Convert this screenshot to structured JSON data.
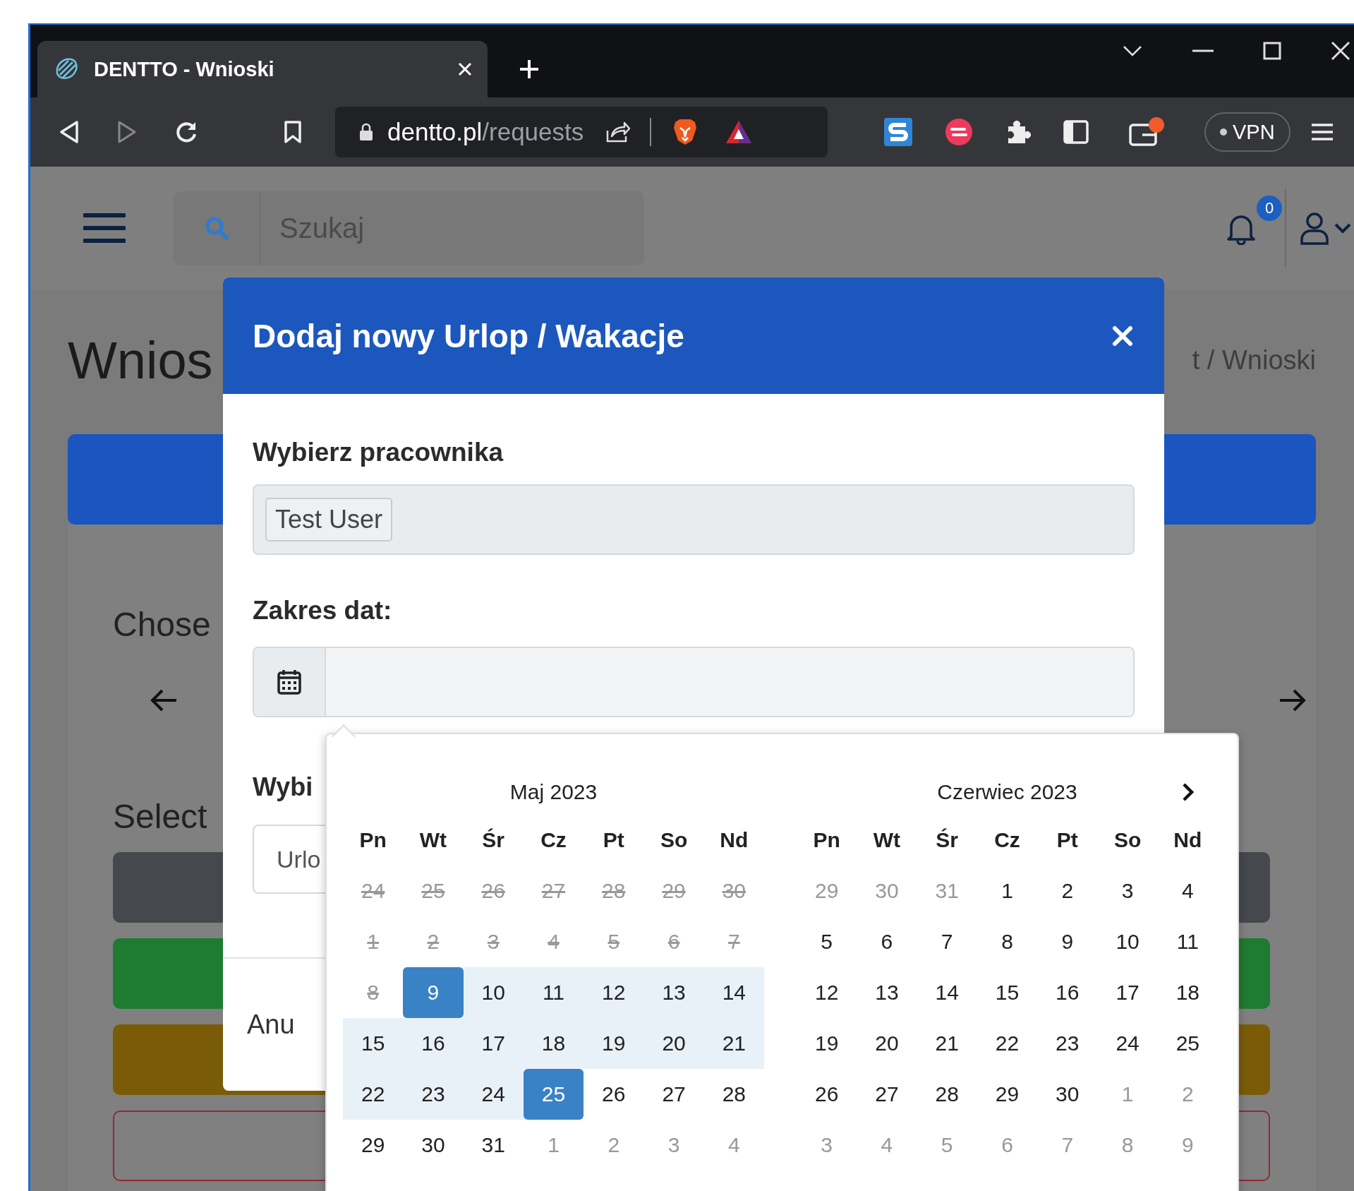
{
  "browser": {
    "tab": {
      "title": "DENTTO - Wnioski"
    },
    "address": {
      "host": "dentto.pl",
      "path": "/requests"
    },
    "vpn": "VPN"
  },
  "header": {
    "search": {
      "placeholder": "Szukaj"
    },
    "notifications": "0"
  },
  "page": {
    "heading": "Wnios",
    "breadcrumb": "t / Wnioski",
    "section_1": "Chose",
    "section_2": "Select",
    "bars": [
      {
        "kind": "filled",
        "color": "#45484d"
      },
      {
        "kind": "filled",
        "color": "#1f7a32"
      },
      {
        "kind": "filled",
        "color": "#7a5c08"
      },
      {
        "kind": "outline",
        "color": "#8c2b33"
      }
    ]
  },
  "modal": {
    "title": "Dodaj nowy Urlop / Wakacje",
    "employee_label": "Wybierz pracownika",
    "employee_tags": [
      "Test User"
    ],
    "date_label": "Zakres dat:",
    "type_label": "Wybi",
    "type_value": "Urlo",
    "cancel": "Anu"
  },
  "datepicker": {
    "calendars": [
      {
        "title": "Maj 2023",
        "weekdays": [
          "Pn",
          "Wt",
          "Śr",
          "Cz",
          "Pt",
          "So",
          "Nd"
        ],
        "weeks": [
          [
            {
              "day": "24",
              "kind": "disabled",
              "selected": false
            },
            {
              "day": "25",
              "kind": "disabled",
              "selected": false
            },
            {
              "day": "26",
              "kind": "disabled",
              "selected": false
            },
            {
              "day": "27",
              "kind": "disabled",
              "selected": false
            },
            {
              "day": "28",
              "kind": "disabled",
              "selected": false
            },
            {
              "day": "29",
              "kind": "disabled",
              "selected": false
            },
            {
              "day": "30",
              "kind": "disabled",
              "selected": false
            }
          ],
          [
            {
              "day": "1",
              "kind": "disabled",
              "selected": false
            },
            {
              "day": "2",
              "kind": "disabled",
              "selected": false
            },
            {
              "day": "3",
              "kind": "disabled",
              "selected": false
            },
            {
              "day": "4",
              "kind": "disabled",
              "selected": false
            },
            {
              "day": "5",
              "kind": "disabled",
              "selected": false
            },
            {
              "day": "6",
              "kind": "disabled",
              "selected": false
            },
            {
              "day": "7",
              "kind": "disabled",
              "selected": false
            }
          ],
          [
            {
              "day": "8",
              "kind": "disabled",
              "selected": false
            },
            {
              "day": "9",
              "kind": "range",
              "selected": true
            },
            {
              "day": "10",
              "kind": "range",
              "selected": false
            },
            {
              "day": "11",
              "kind": "range",
              "selected": false
            },
            {
              "day": "12",
              "kind": "range",
              "selected": false
            },
            {
              "day": "13",
              "kind": "range",
              "selected": false
            },
            {
              "day": "14",
              "kind": "range",
              "selected": false
            }
          ],
          [
            {
              "day": "15",
              "kind": "range",
              "selected": false
            },
            {
              "day": "16",
              "kind": "range",
              "selected": false
            },
            {
              "day": "17",
              "kind": "range",
              "selected": false
            },
            {
              "day": "18",
              "kind": "range",
              "selected": false
            },
            {
              "day": "19",
              "kind": "range",
              "selected": false
            },
            {
              "day": "20",
              "kind": "range",
              "selected": false
            },
            {
              "day": "21",
              "kind": "range",
              "selected": false
            }
          ],
          [
            {
              "day": "22",
              "kind": "range",
              "selected": false
            },
            {
              "day": "23",
              "kind": "range",
              "selected": false
            },
            {
              "day": "24",
              "kind": "range",
              "selected": false
            },
            {
              "day": "25",
              "kind": "range",
              "selected": true
            },
            {
              "day": "26",
              "kind": "normal",
              "selected": false
            },
            {
              "day": "27",
              "kind": "normal",
              "selected": false
            },
            {
              "day": "28",
              "kind": "normal",
              "selected": false
            }
          ],
          [
            {
              "day": "29",
              "kind": "normal",
              "selected": false
            },
            {
              "day": "30",
              "kind": "normal",
              "selected": false
            },
            {
              "day": "31",
              "kind": "normal",
              "selected": false
            },
            {
              "day": "1",
              "kind": "outside",
              "selected": false
            },
            {
              "day": "2",
              "kind": "outside",
              "selected": false
            },
            {
              "day": "3",
              "kind": "outside",
              "selected": false
            },
            {
              "day": "4",
              "kind": "outside",
              "selected": false
            }
          ]
        ]
      },
      {
        "title": "Czerwiec 2023",
        "weekdays": [
          "Pn",
          "Wt",
          "Śr",
          "Cz",
          "Pt",
          "So",
          "Nd"
        ],
        "weeks": [
          [
            {
              "day": "29",
              "kind": "outside",
              "selected": false
            },
            {
              "day": "30",
              "kind": "outside",
              "selected": false
            },
            {
              "day": "31",
              "kind": "outside",
              "selected": false
            },
            {
              "day": "1",
              "kind": "normal",
              "selected": false
            },
            {
              "day": "2",
              "kind": "normal",
              "selected": false
            },
            {
              "day": "3",
              "kind": "normal",
              "selected": false
            },
            {
              "day": "4",
              "kind": "normal",
              "selected": false
            }
          ],
          [
            {
              "day": "5",
              "kind": "normal",
              "selected": false
            },
            {
              "day": "6",
              "kind": "normal",
              "selected": false
            },
            {
              "day": "7",
              "kind": "normal",
              "selected": false
            },
            {
              "day": "8",
              "kind": "normal",
              "selected": false
            },
            {
              "day": "9",
              "kind": "normal",
              "selected": false
            },
            {
              "day": "10",
              "kind": "normal",
              "selected": false
            },
            {
              "day": "11",
              "kind": "normal",
              "selected": false
            }
          ],
          [
            {
              "day": "12",
              "kind": "normal",
              "selected": false
            },
            {
              "day": "13",
              "kind": "normal",
              "selected": false
            },
            {
              "day": "14",
              "kind": "normal",
              "selected": false
            },
            {
              "day": "15",
              "kind": "normal",
              "selected": false
            },
            {
              "day": "16",
              "kind": "normal",
              "selected": false
            },
            {
              "day": "17",
              "kind": "normal",
              "selected": false
            },
            {
              "day": "18",
              "kind": "normal",
              "selected": false
            }
          ],
          [
            {
              "day": "19",
              "kind": "normal",
              "selected": false
            },
            {
              "day": "20",
              "kind": "normal",
              "selected": false
            },
            {
              "day": "21",
              "kind": "normal",
              "selected": false
            },
            {
              "day": "22",
              "kind": "normal",
              "selected": false
            },
            {
              "day": "23",
              "kind": "normal",
              "selected": false
            },
            {
              "day": "24",
              "kind": "normal",
              "selected": false
            },
            {
              "day": "25",
              "kind": "normal",
              "selected": false
            }
          ],
          [
            {
              "day": "26",
              "kind": "normal",
              "selected": false
            },
            {
              "day": "27",
              "kind": "normal",
              "selected": false
            },
            {
              "day": "28",
              "kind": "normal",
              "selected": false
            },
            {
              "day": "29",
              "kind": "normal",
              "selected": false
            },
            {
              "day": "30",
              "kind": "normal",
              "selected": false
            },
            {
              "day": "1",
              "kind": "outside",
              "selected": false
            },
            {
              "day": "2",
              "kind": "outside",
              "selected": false
            }
          ],
          [
            {
              "day": "3",
              "kind": "outside",
              "selected": false
            },
            {
              "day": "4",
              "kind": "outside",
              "selected": false
            },
            {
              "day": "5",
              "kind": "outside",
              "selected": false
            },
            {
              "day": "6",
              "kind": "outside",
              "selected": false
            },
            {
              "day": "7",
              "kind": "outside",
              "selected": false
            },
            {
              "day": "8",
              "kind": "outside",
              "selected": false
            },
            {
              "day": "9",
              "kind": "outside",
              "selected": false
            }
          ]
        ]
      }
    ]
  }
}
